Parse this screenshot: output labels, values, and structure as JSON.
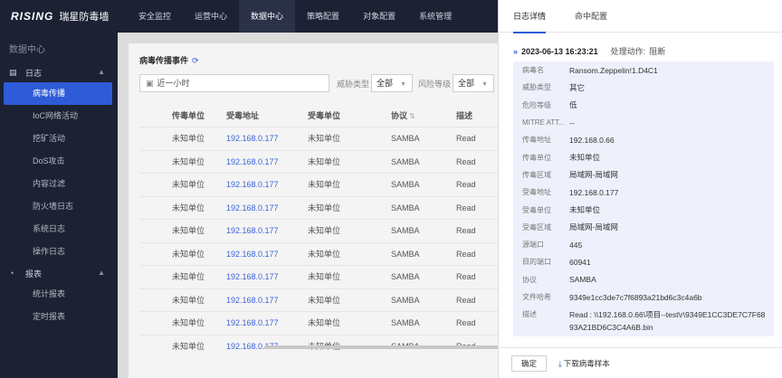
{
  "app": {
    "brand": "RISING",
    "product": "瑞星防毒墙"
  },
  "topnav": [
    {
      "label": "安全监控"
    },
    {
      "label": "运营中心"
    },
    {
      "label": "数据中心"
    },
    {
      "label": "策略配置"
    },
    {
      "label": "对象配置"
    },
    {
      "label": "系统管理"
    }
  ],
  "sidebar": {
    "header": "数据中心",
    "group_log": "日志",
    "log_items": [
      {
        "label": "病毒传播"
      },
      {
        "label": "IoC网络活动"
      },
      {
        "label": "挖矿活动"
      },
      {
        "label": "DoS攻击"
      },
      {
        "label": "内容过滤"
      },
      {
        "label": "防火墙日志"
      },
      {
        "label": "系统日志"
      },
      {
        "label": "操作日志"
      }
    ],
    "group_report": "报表",
    "report_items": [
      {
        "label": "统计报表"
      },
      {
        "label": "定时报表"
      }
    ]
  },
  "main": {
    "title": "病毒传播事件",
    "time_filter": "近一小时",
    "threat_type_label": "威胁类型",
    "threat_type_value": "全部",
    "risk_level_label": "风险等级",
    "risk_level_value": "全部",
    "columns": [
      "传毒单位",
      "受毒地址",
      "受毒单位",
      "协议",
      "描述"
    ],
    "rows": [
      {
        "src_unit": "未知单位",
        "dst_addr": "192.168.0.177",
        "dst_unit": "未知单位",
        "proto": "SAMBA",
        "desc": "Read"
      },
      {
        "src_unit": "未知单位",
        "dst_addr": "192.168.0.177",
        "dst_unit": "未知单位",
        "proto": "SAMBA",
        "desc": "Read"
      },
      {
        "src_unit": "未知单位",
        "dst_addr": "192.168.0.177",
        "dst_unit": "未知单位",
        "proto": "SAMBA",
        "desc": "Read"
      },
      {
        "src_unit": "未知单位",
        "dst_addr": "192.168.0.177",
        "dst_unit": "未知单位",
        "proto": "SAMBA",
        "desc": "Read"
      },
      {
        "src_unit": "未知单位",
        "dst_addr": "192.168.0.177",
        "dst_unit": "未知单位",
        "proto": "SAMBA",
        "desc": "Read"
      },
      {
        "src_unit": "未知单位",
        "dst_addr": "192.168.0.177",
        "dst_unit": "未知单位",
        "proto": "SAMBA",
        "desc": "Read"
      },
      {
        "src_unit": "未知单位",
        "dst_addr": "192.168.0.177",
        "dst_unit": "未知单位",
        "proto": "SAMBA",
        "desc": "Read"
      },
      {
        "src_unit": "未知单位",
        "dst_addr": "192.168.0.177",
        "dst_unit": "未知单位",
        "proto": "SAMBA",
        "desc": "Read"
      },
      {
        "src_unit": "未知单位",
        "dst_addr": "192.168.0.177",
        "dst_unit": "未知单位",
        "proto": "SAMBA",
        "desc": "Read"
      },
      {
        "src_unit": "未知单位",
        "dst_addr": "192.168.0.177",
        "dst_unit": "未知单位",
        "proto": "SAMBA",
        "desc": "Read"
      }
    ]
  },
  "drawer": {
    "tab_detail": "日志详情",
    "tab_config": "命中配置",
    "event_time": "2023-06-13 16:23:21",
    "action_label": "处理动作:",
    "action_value": "阻断",
    "fields": [
      {
        "key": "病毒名",
        "value": "Ransom.Zeppelin!1.D4C1"
      },
      {
        "key": "威胁类型",
        "value": "其它"
      },
      {
        "key": "危险等级",
        "value": "低"
      },
      {
        "key": "MITRE ATT...",
        "value": "--"
      },
      {
        "key": "传毒地址",
        "value": "192.168.0.66"
      },
      {
        "key": "传毒单位",
        "value": "未知单位"
      },
      {
        "key": "传毒区域",
        "value": "局域网-局域网"
      },
      {
        "key": "受毒地址",
        "value": "192.168.0.177"
      },
      {
        "key": "受毒单位",
        "value": "未知单位"
      },
      {
        "key": "受毒区域",
        "value": "局域网-局域网"
      },
      {
        "key": "源端口",
        "value": "445"
      },
      {
        "key": "目的端口",
        "value": "60941"
      },
      {
        "key": "协议",
        "value": "SAMBA"
      },
      {
        "key": "文件哈希",
        "value": "9349e1cc3de7c7f6893a21bd6c3c4a6b"
      }
    ],
    "desc_key": "描述",
    "desc_value": "Read : \\\\192.168.0.66\\项目--test\\r\\9349E1CC3DE7C7F6893A21BD6C3C4A6B.bin",
    "ok_button": "确定",
    "download_button": "下载病毒样本"
  },
  "colors": {
    "dark_bg": "#1c2233",
    "accent": "#2f5bd8",
    "detail_bg": "#eef1fb"
  }
}
